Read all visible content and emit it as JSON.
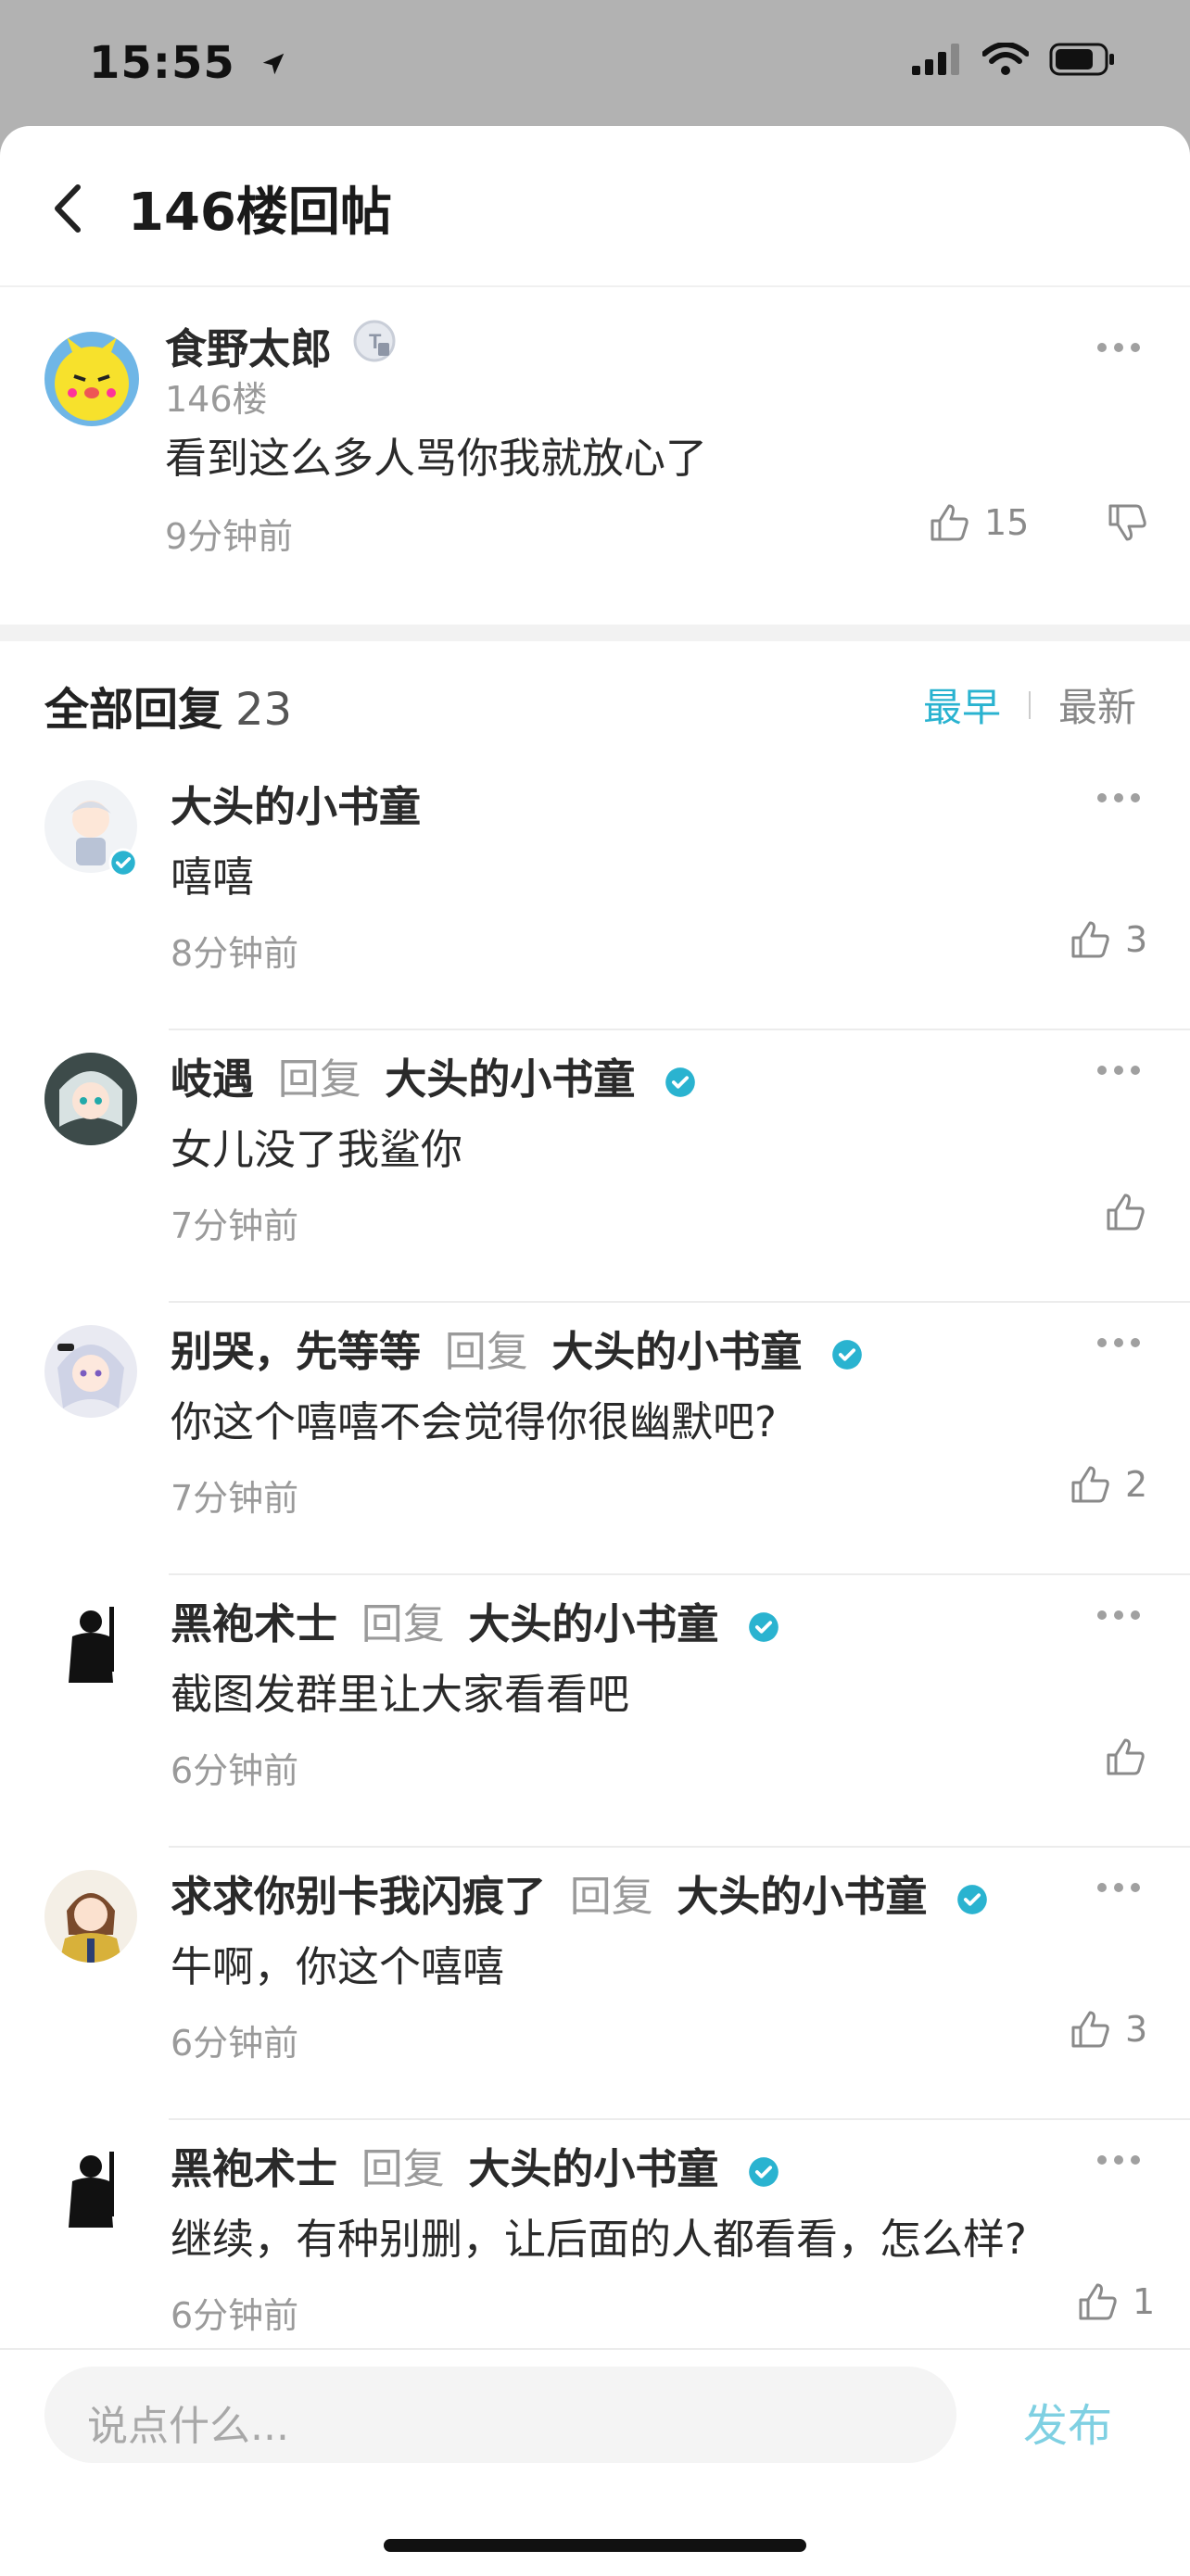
{
  "status_bar": {
    "time": "15:55"
  },
  "header": {
    "title": "146楼回帖"
  },
  "floor_post": {
    "author": "食野太郎",
    "floor": "146楼",
    "content": "看到这么多人骂你我就放心了",
    "time": "9分钟前",
    "likes": "15"
  },
  "replies_section": {
    "title": "全部回复",
    "count": "23",
    "sort_earliest": "最早",
    "sort_latest": "最新"
  },
  "replies": [
    {
      "author": "大头的小书童",
      "reply_label": "",
      "reply_to": "",
      "content": "嘻嘻",
      "time": "8分钟前",
      "likes": "3"
    },
    {
      "author": "岐遇",
      "reply_label": "回复",
      "reply_to": "大头的小书童",
      "content": "女儿没了我鲨你",
      "time": "7分钟前",
      "likes": ""
    },
    {
      "author": "别哭，先等等",
      "reply_label": "回复",
      "reply_to": "大头的小书童",
      "content": "你这个嘻嘻不会觉得你很幽默吧?",
      "time": "7分钟前",
      "likes": "2"
    },
    {
      "author": "黑袍术士",
      "reply_label": "回复",
      "reply_to": "大头的小书童",
      "content": "截图发群里让大家看看吧",
      "time": "6分钟前",
      "likes": ""
    },
    {
      "author": "求求你别卡我闪痕了",
      "reply_label": "回复",
      "reply_to": "大头的小书童",
      "content": "牛啊，你这个嘻嘻",
      "time": "6分钟前",
      "likes": "3"
    },
    {
      "author": "黑袍术士",
      "reply_label": "回复",
      "reply_to": "大头的小书童",
      "content": "继续，有种别删，让后面的人都看看，怎么样?",
      "time": "6分钟前",
      "likes": "1"
    }
  ],
  "composer": {
    "placeholder": "说点什么...",
    "publish_label": "发布"
  },
  "colors": {
    "accent": "#2ab3d0",
    "verified": "#2ab3d0",
    "muted_text": "#9a9a9a"
  }
}
